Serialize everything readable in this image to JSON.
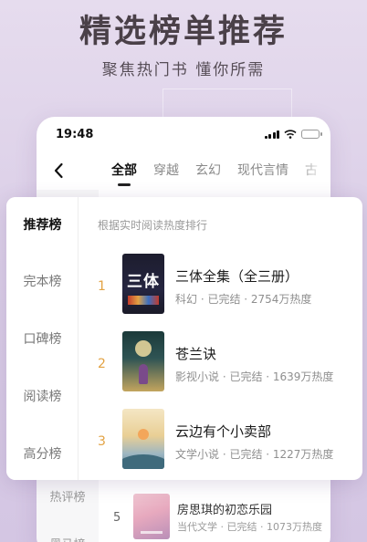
{
  "promo": {
    "title": "精选榜单推荐",
    "subtitle": "聚焦热门书 懂你所需"
  },
  "status_bar": {
    "time": "19:48",
    "icons": [
      "signal-icon",
      "wifi-icon",
      "battery-icon"
    ],
    "battery_color": "#f5c518"
  },
  "top_nav": {
    "back_icon": "chevron-left-icon",
    "tabs": [
      {
        "label": "全部",
        "active": true
      },
      {
        "label": "穿越",
        "active": false
      },
      {
        "label": "玄幻",
        "active": false
      },
      {
        "label": "现代言情",
        "active": false
      },
      {
        "label": "古",
        "active": false
      }
    ]
  },
  "background_list": {
    "sidebar": [
      "热评榜",
      "黑马榜"
    ],
    "row": {
      "rank": "5",
      "title": "房思琪的初恋乐园",
      "meta": "当代文学 · 已完结 · 1073万热度"
    }
  },
  "ranking_panel": {
    "sidebar": [
      {
        "label": "推荐榜",
        "active": true
      },
      {
        "label": "完本榜",
        "active": false
      },
      {
        "label": "口碑榜",
        "active": false
      },
      {
        "label": "阅读榜",
        "active": false
      },
      {
        "label": "高分榜",
        "active": false
      }
    ],
    "heading": "根据实时阅读热度排行",
    "books": [
      {
        "rank": "1",
        "title": "三体全集（全三册）",
        "meta": "科幻 · 已完结 · 2754万热度",
        "cover_text": "三体"
      },
      {
        "rank": "2",
        "title": "苍兰诀",
        "meta": "影视小说 · 已完结 · 1639万热度"
      },
      {
        "rank": "3",
        "title": "云边有个小卖部",
        "meta": "文学小说 · 已完结 · 1227万热度"
      }
    ],
    "rank_color": "#e2a243"
  }
}
